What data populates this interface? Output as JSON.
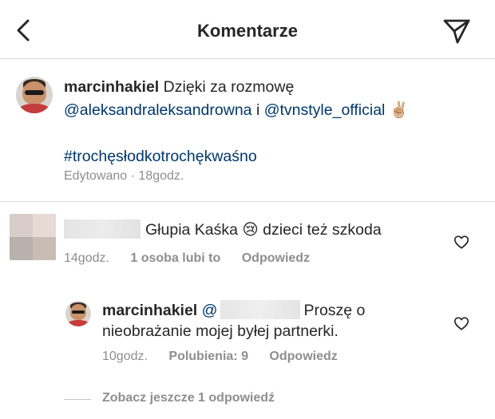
{
  "header": {
    "title": "Komentarze",
    "back_icon": "chevron-left-icon",
    "send_icon": "paper-plane-icon"
  },
  "caption": {
    "username": "marcinhakiel",
    "text_start": "Dzięki za rozmowę",
    "mention1": "@aleksandraleksandrowna",
    "conjunction": "i",
    "mention2": "@tvnstyle_official",
    "emoji": "✌🏼",
    "hashtag": "#trochęsłodkotrochękwaśno",
    "edited": "Edytowano",
    "separator": "·",
    "time": "18godz."
  },
  "comments": [
    {
      "text_before_emoji": "Głupia Kaśka",
      "emoji": "😢",
      "text_after_emoji": "dzieci też szkoda",
      "time": "14godz.",
      "likes": "1 osoba lubi to",
      "reply": "Odpowiedz",
      "avatar_colors": [
        "#d8cdc8",
        "#e6dad4",
        "#b9b1ad",
        "#c9bcb4"
      ]
    },
    {
      "username": "marcinhakiel",
      "mention_prefix": "@",
      "text_line1": "Proszę o",
      "text_line2": "nieobrażanie mojej byłej partnerki.",
      "time": "10godz.",
      "likes": "Polubienia: 9",
      "reply": "Odpowiedz"
    }
  ],
  "view_more": "Zobacz jeszcze 1 odpowiedź",
  "colors": {
    "text": "#262626",
    "secondary": "#8e8e8e",
    "link": "#00376b",
    "divider": "#dbdbdb"
  }
}
